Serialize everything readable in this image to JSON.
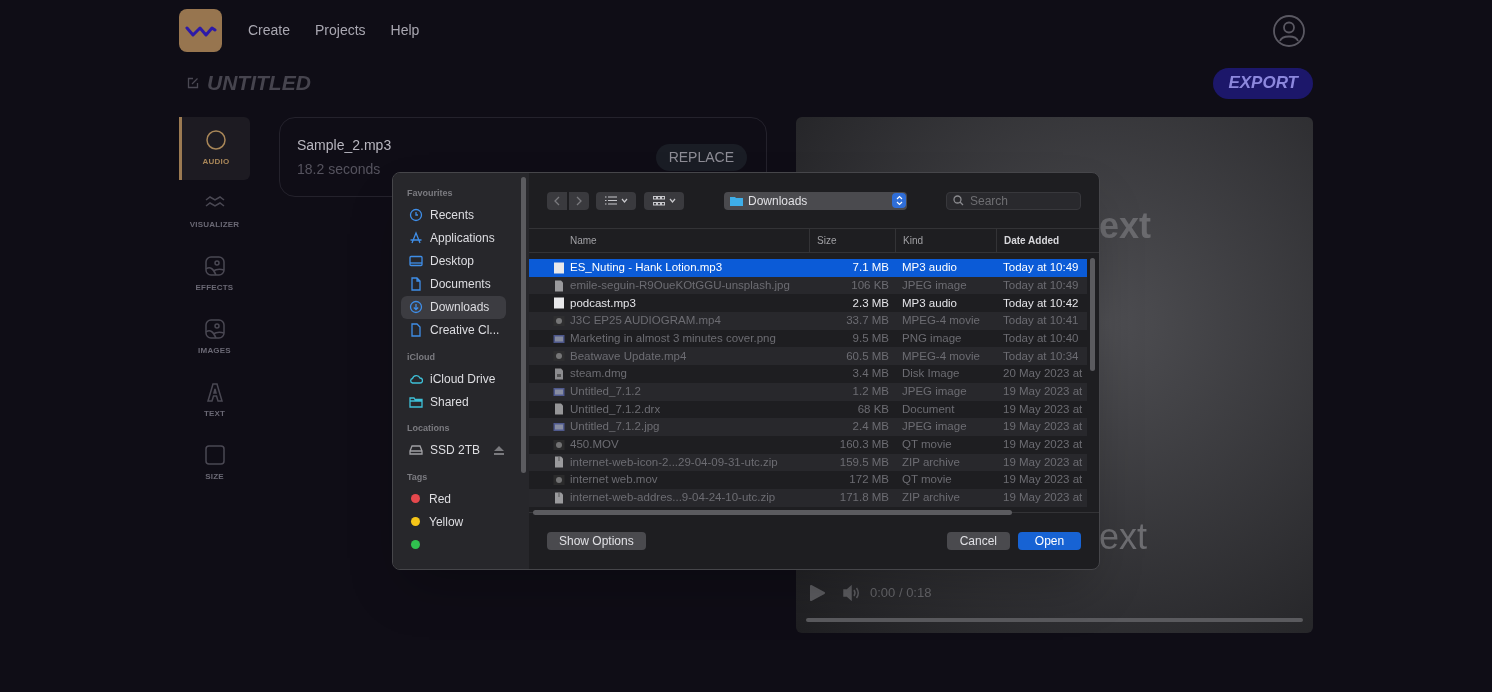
{
  "nav": {
    "items": [
      "Create",
      "Projects",
      "Help"
    ]
  },
  "project": {
    "title": "UNTITLED",
    "export_label": "EXPORT"
  },
  "tools": [
    {
      "label": "AUDIO",
      "kind": "circle",
      "selected": true
    },
    {
      "label": "VISUALIZER",
      "kind": "wave",
      "selected": false
    },
    {
      "label": "EFFECTS",
      "kind": "picture",
      "selected": false
    },
    {
      "label": "IMAGES",
      "kind": "picture",
      "selected": false
    },
    {
      "label": "TEXT",
      "kind": "letter",
      "selected": false
    },
    {
      "label": "SIZE",
      "kind": "square",
      "selected": false
    }
  ],
  "audio_card": {
    "file_name": "Sample_2.mp3",
    "duration": "18.2 seconds",
    "replace_label": "REPLACE"
  },
  "preview": {
    "texts": [
      "ext",
      "ext"
    ],
    "time": "0:00 / 0:18",
    "level": 0
  },
  "dialog": {
    "sidebar": [
      {
        "heading": "Favourites",
        "items": [
          {
            "label": "Recents",
            "kind": "clock",
            "selected": false
          },
          {
            "label": "Applications",
            "kind": "apps",
            "selected": false
          },
          {
            "label": "Desktop",
            "kind": "desktop",
            "selected": false
          },
          {
            "label": "Documents",
            "kind": "document",
            "selected": false
          },
          {
            "label": "Downloads",
            "kind": "download",
            "selected": true
          },
          {
            "label": "Creative Cl...",
            "kind": "file",
            "selected": false
          }
        ]
      },
      {
        "heading": "iCloud",
        "items": [
          {
            "label": "iCloud Drive",
            "kind": "cloud",
            "selected": false
          },
          {
            "label": "Shared",
            "kind": "folder",
            "selected": false
          }
        ]
      },
      {
        "heading": "Locations",
        "items": [
          {
            "label": "SSD 2TB",
            "kind": "drive",
            "selected": false
          }
        ]
      },
      {
        "heading": "Tags",
        "items": [
          {
            "label": "Red",
            "kind": "tag",
            "color": "#e5484d",
            "selected": false
          },
          {
            "label": "Yellow",
            "kind": "tag",
            "color": "#f5c518",
            "selected": false
          },
          {
            "kind": "tag",
            "color": "#30c04f",
            "selected": false
          }
        ]
      }
    ],
    "location": "Downloads",
    "search": {
      "placeholder": "Search"
    },
    "columns": [
      "Name",
      "Size",
      "Kind",
      "Date Added"
    ],
    "rows": [
      {
        "name": "ES_Nuting - Hank Lotion.mp3",
        "size": "7.1 MB",
        "kind_label": "MP3 audio",
        "date": "Today at 10:49",
        "kind": "audio",
        "enabled": true,
        "selected": true
      },
      {
        "name": "emile-seguin-R9OueKOtGGU-unsplash.jpg",
        "size": "106 KB",
        "kind_label": "JPEG image",
        "date": "Today at 10:49",
        "kind": "document",
        "enabled": false,
        "selected": false
      },
      {
        "name": "podcast.mp3",
        "size": "2.3 MB",
        "kind_label": "MP3 audio",
        "date": "Today at 10:42",
        "kind": "audio",
        "enabled": true,
        "selected": false
      },
      {
        "name": "J3C EP25 AUDIOGRAM.mp4",
        "size": "33.7 MB",
        "kind_label": "MPEG-4 movie",
        "date": "Today at 10:41",
        "kind": "movie",
        "enabled": false,
        "selected": false
      },
      {
        "name": "Marketing in almost 3 minutes cover.png",
        "size": "9.5 MB",
        "kind_label": "PNG image",
        "date": "Today at 10:40",
        "kind": "image",
        "enabled": false,
        "selected": false
      },
      {
        "name": "Beatwave Update.mp4",
        "size": "60.5 MB",
        "kind_label": "MPEG-4 movie",
        "date": "Today at 10:34",
        "kind": "movie",
        "enabled": false,
        "selected": false
      },
      {
        "name": "steam.dmg",
        "size": "3.4 MB",
        "kind_label": "Disk Image",
        "date": "20 May 2023 at",
        "kind": "disk",
        "enabled": false,
        "selected": false
      },
      {
        "name": "Untitled_7.1.2",
        "size": "1.2 MB",
        "kind_label": "JPEG image",
        "date": "19 May 2023 at",
        "kind": "image",
        "enabled": false,
        "selected": false
      },
      {
        "name": "Untitled_7.1.2.drx",
        "size": "68 KB",
        "kind_label": "Document",
        "date": "19 May 2023 at",
        "kind": "document",
        "enabled": false,
        "selected": false
      },
      {
        "name": "Untitled_7.1.2.jpg",
        "size": "2.4 MB",
        "kind_label": "JPEG image",
        "date": "19 May 2023 at",
        "kind": "image",
        "enabled": false,
        "selected": false
      },
      {
        "name": "450.MOV",
        "size": "160.3 MB",
        "kind_label": "QT movie",
        "date": "19 May 2023 at",
        "kind": "movie",
        "enabled": false,
        "selected": false
      },
      {
        "name": "internet-web-icon-2...29-04-09-31-utc.zip",
        "size": "159.5 MB",
        "kind_label": "ZIP archive",
        "date": "19 May 2023 at",
        "kind": "archive",
        "enabled": false,
        "selected": false
      },
      {
        "name": "internet web.mov",
        "size": "172 MB",
        "kind_label": "QT movie",
        "date": "19 May 2023 at",
        "kind": "movie",
        "enabled": false,
        "selected": false
      },
      {
        "name": "internet-web-addres...9-04-24-10-utc.zip",
        "size": "171.8 MB",
        "kind_label": "ZIP archive",
        "date": "19 May 2023 at",
        "kind": "archive",
        "enabled": false,
        "selected": false
      }
    ],
    "show_options_label": "Show Options",
    "cancel_label": "Cancel",
    "open_label": "Open"
  }
}
